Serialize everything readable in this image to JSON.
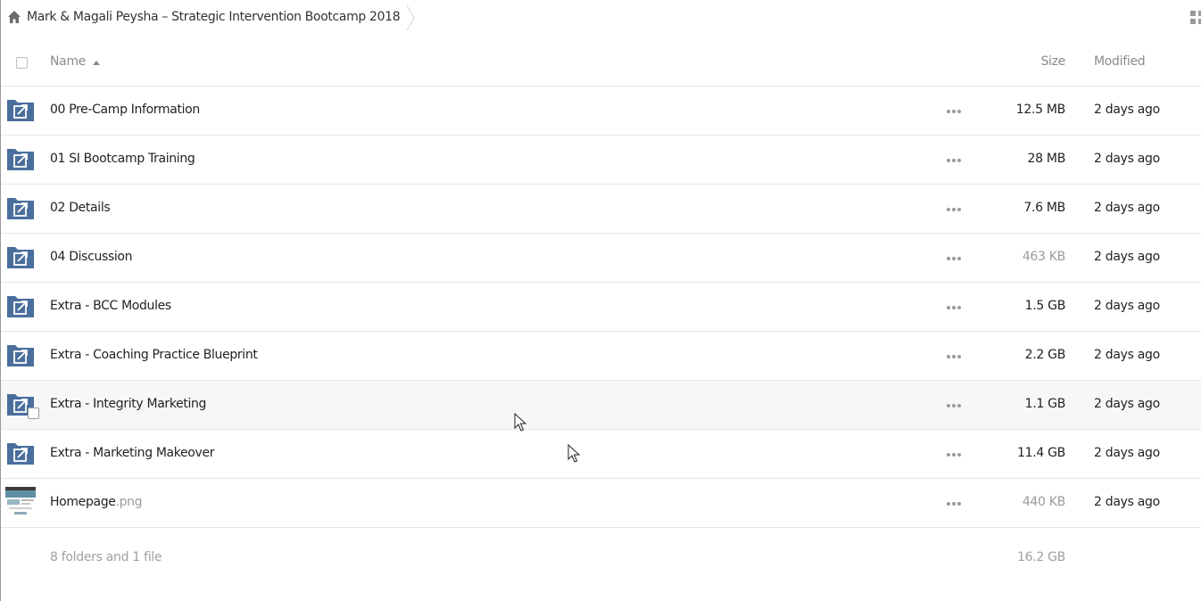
{
  "breadcrumb": {
    "home_icon": "home-icon",
    "current": "Mark & Magali Peysha – Strategic Intervention Bootcamp 2018"
  },
  "view_toggle_icon": "grid-view-icon",
  "columns": {
    "name": "Name",
    "size": "Size",
    "modified": "Modified",
    "sort": "ascending"
  },
  "files": [
    {
      "name": "00 Pre-Camp Information",
      "ext": "",
      "type": "shared-folder",
      "size": "12.5 MB",
      "modified": "2 days ago",
      "size_light": false
    },
    {
      "name": "01 SI Bootcamp Training",
      "ext": "",
      "type": "shared-folder",
      "size": "28 MB",
      "modified": "2 days ago",
      "size_light": false
    },
    {
      "name": "02 Details",
      "ext": "",
      "type": "shared-folder",
      "size": "7.6 MB",
      "modified": "2 days ago",
      "size_light": false
    },
    {
      "name": "04 Discussion",
      "ext": "",
      "type": "shared-folder",
      "size": "463 KB",
      "modified": "2 days ago",
      "size_light": true
    },
    {
      "name": "Extra - BCC Modules",
      "ext": "",
      "type": "shared-folder",
      "size": "1.5 GB",
      "modified": "2 days ago",
      "size_light": false
    },
    {
      "name": "Extra - Coaching Practice Blueprint",
      "ext": "",
      "type": "shared-folder",
      "size": "2.2 GB",
      "modified": "2 days ago",
      "size_light": false
    },
    {
      "name": "Extra - Integrity Marketing",
      "ext": "",
      "type": "shared-folder",
      "size": "1.1 GB",
      "modified": "2 days ago",
      "size_light": false,
      "hovered": true
    },
    {
      "name": "Extra - Marketing Makeover",
      "ext": "",
      "type": "shared-folder",
      "size": "11.4 GB",
      "modified": "2 days ago",
      "size_light": false
    },
    {
      "name": "Homepage",
      "ext": ".png",
      "type": "image",
      "size": "440 KB",
      "modified": "2 days ago",
      "size_light": true
    }
  ],
  "summary": {
    "text": "8 folders and 1 file",
    "total_size": "16.2 GB"
  },
  "colors": {
    "folder": "#4a6f9d",
    "muted_text": "#8a8a8a",
    "row_border": "#e6e6e6"
  }
}
